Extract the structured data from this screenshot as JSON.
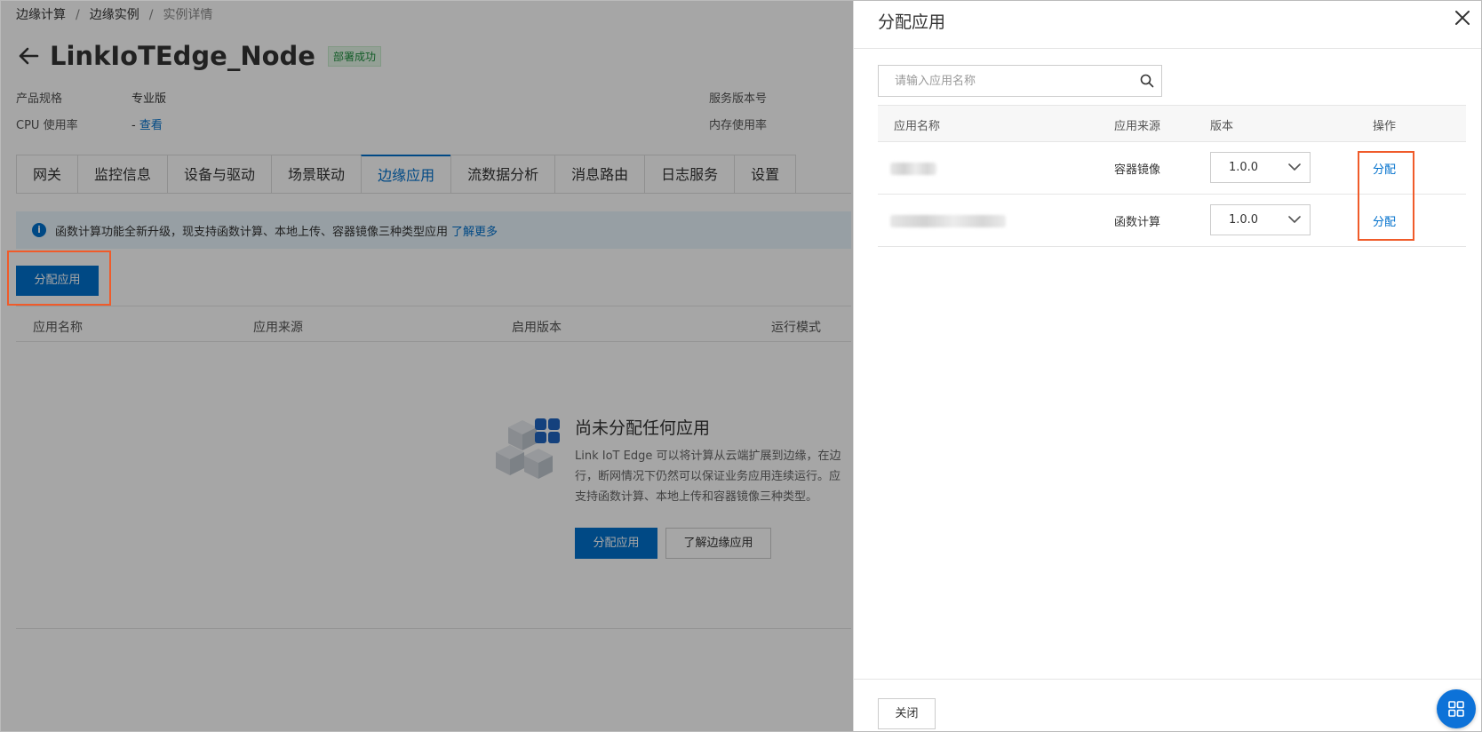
{
  "breadcrumb": {
    "items": [
      "边缘计算",
      "边缘实例",
      "实例详情"
    ],
    "separator": "/"
  },
  "header": {
    "title": "LinkIoTEdge_Node",
    "status_badge": "部署成功"
  },
  "info": {
    "spec_label": "产品规格",
    "spec_value": "专业版",
    "cpu_label": "CPU 使用率",
    "cpu_value_prefix": "-",
    "cpu_link": "查看",
    "service_version_label": "服务版本号",
    "memory_label": "内存使用率"
  },
  "tabs": [
    {
      "label": "网关"
    },
    {
      "label": "监控信息"
    },
    {
      "label": "设备与驱动"
    },
    {
      "label": "场景联动"
    },
    {
      "label": "边缘应用",
      "active": true
    },
    {
      "label": "流数据分析"
    },
    {
      "label": "消息路由"
    },
    {
      "label": "日志服务"
    },
    {
      "label": "设置"
    }
  ],
  "notice": {
    "icon": "info-icon",
    "text": "函数计算功能全新升级，现支持函数计算、本地上传、容器镜像三种类型应用",
    "link": "了解更多"
  },
  "main": {
    "assign_button": "分配应用",
    "table_headers": [
      "应用名称",
      "应用来源",
      "启用版本",
      "运行模式"
    ],
    "empty": {
      "title": "尚未分配任何应用",
      "desc_lines": [
        "Link IoT Edge 可以将计算从云端扩展到边缘，在边",
        "行，断网情况下仍然可以保证业务应用连续运行。应",
        "支持函数计算、本地上传和容器镜像三种类型。"
      ],
      "primary_button": "分配应用",
      "secondary_button": "了解边缘应用"
    }
  },
  "drawer": {
    "title": "分配应用",
    "close_icon": "close-icon",
    "search_placeholder": "请输入应用名称",
    "search_icon": "search-icon",
    "table_headers": [
      "应用名称",
      "应用来源",
      "版本",
      "操作"
    ],
    "rows": [
      {
        "source": "容器镜像",
        "version": "1.0.0",
        "action": "分配"
      },
      {
        "source": "函数计算",
        "version": "1.0.0",
        "action": "分配"
      }
    ],
    "footer_button": "关闭"
  },
  "colors": {
    "primary": "#0070cc",
    "highlight_box": "#f05b2a",
    "success": "#1e8e3e",
    "overlay": "rgba(0,0,0,0.35)"
  }
}
